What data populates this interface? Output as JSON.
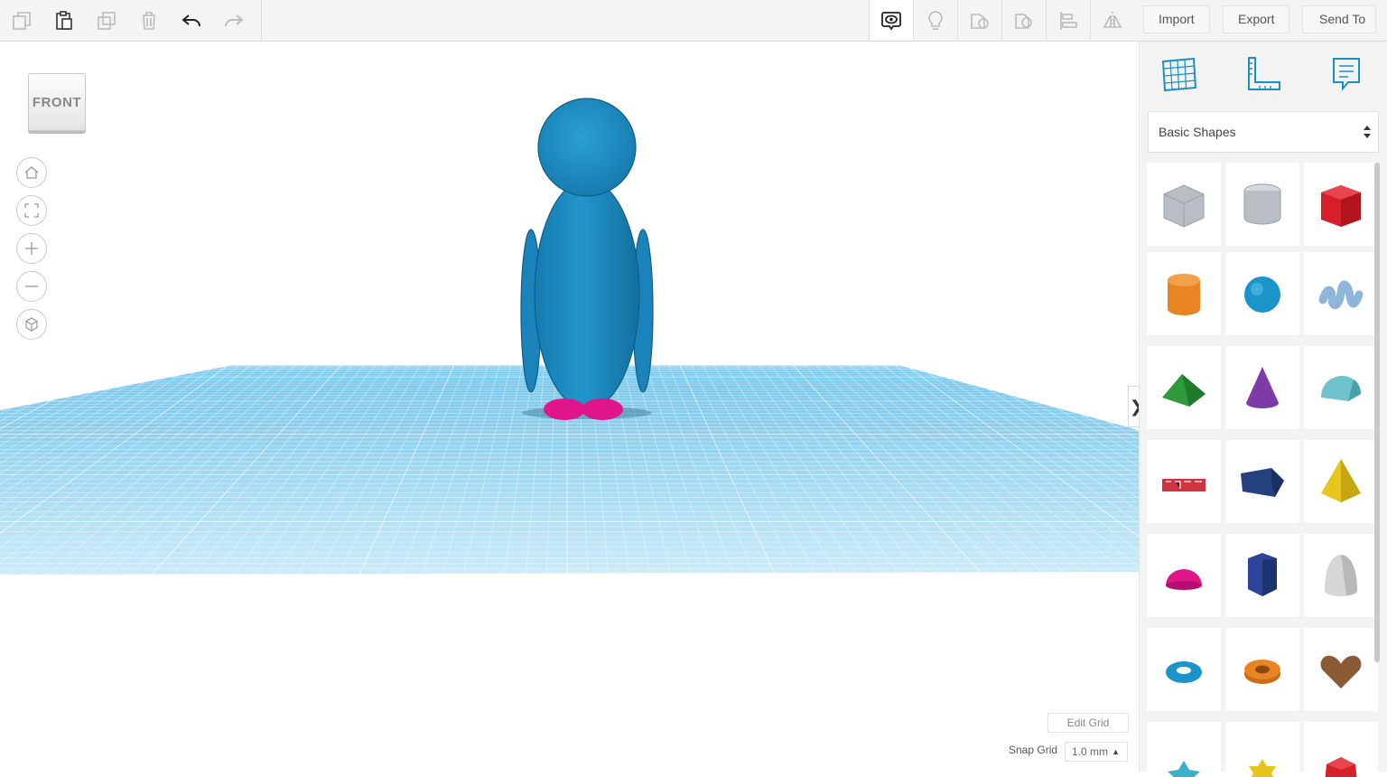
{
  "toolbar": {
    "import_label": "Import",
    "export_label": "Export",
    "send_to_label": "Send To",
    "left_tools": [
      "copy-icon",
      "paste-icon",
      "duplicate-icon",
      "delete-icon",
      "undo-icon",
      "redo-icon"
    ],
    "right_tools": [
      "show-all-icon",
      "note-lightbulb-icon",
      "solid-shape-icon",
      "hole-shape-icon",
      "align-icon",
      "mirror-icon"
    ]
  },
  "viewport": {
    "view_cube_label": "FRONT",
    "view_controls": [
      "home-view-icon",
      "fit-view-icon",
      "zoom-in-icon",
      "zoom-out-icon",
      "perspective-icon"
    ],
    "edit_grid_label": "Edit Grid",
    "snap_grid_label": "Snap Grid",
    "snap_grid_value": "1.0 mm",
    "model_colors": {
      "body": "#1f8fc2",
      "feet": "#e0158a",
      "plane": "#8fd0ee"
    }
  },
  "panel": {
    "tabs": [
      "workplane-grid-icon",
      "ruler-icon",
      "notes-icon"
    ],
    "library_selected": "Basic Shapes",
    "shapes": [
      {
        "name": "box-hole",
        "color": "#b9bec4"
      },
      {
        "name": "cylinder-hole",
        "color": "#b9bec4"
      },
      {
        "name": "box",
        "color": "#d5202b"
      },
      {
        "name": "cylinder",
        "color": "#e98423"
      },
      {
        "name": "sphere",
        "color": "#1b94c9"
      },
      {
        "name": "scribble",
        "color": "#8fb6d8"
      },
      {
        "name": "roof",
        "color": "#2e9a3a"
      },
      {
        "name": "cone",
        "color": "#7d3ba5"
      },
      {
        "name": "round-roof",
        "color": "#6ec3cf"
      },
      {
        "name": "text",
        "color": "#c81e2a"
      },
      {
        "name": "polygon",
        "color": "#25407f"
      },
      {
        "name": "pyramid",
        "color": "#e8c51c"
      },
      {
        "name": "half-sphere",
        "color": "#e0158a"
      },
      {
        "name": "hexagonal-prism",
        "color": "#2d449a"
      },
      {
        "name": "paraboloid",
        "color": "#d6d6d6"
      },
      {
        "name": "torus",
        "color": "#1b94c9"
      },
      {
        "name": "tube",
        "color": "#e98423"
      },
      {
        "name": "heart",
        "color": "#8a5a34"
      },
      {
        "name": "star",
        "color": "#3ab0c9"
      },
      {
        "name": "star-six-point",
        "color": "#e8c51c"
      },
      {
        "name": "icosahedron",
        "color": "#d5202b"
      }
    ]
  }
}
